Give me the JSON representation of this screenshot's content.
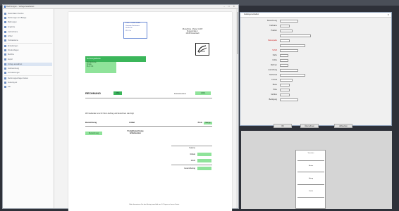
{
  "top_strip": {
    "title": ""
  },
  "window": {
    "title": "Rechnungen – Vorlage bearbeiten",
    "controls": "–  □  ✕"
  },
  "sidebar": {
    "items": [
      {
        "label": "Stammdaten Kunden"
      },
      {
        "label": "Rechnungen und Belege"
      },
      {
        "label": "Mahnungen"
      },
      {
        "label": "Angebote"
      },
      {
        "label": "Lieferscheine"
      },
      {
        "label": "Artikel"
      },
      {
        "label": "Textbausteine"
      },
      {
        "label": "Einstellungen"
      },
      {
        "label": "Druckvorlagen"
      },
      {
        "label": "Berichte"
      },
      {
        "label": "Export"
      },
      {
        "label": "Vorlage auswählen"
      },
      {
        "label": "Feldzuordnung"
      },
      {
        "label": "Formatierungen"
      },
      {
        "label": "Rechnungsvorlage drucken"
      },
      {
        "label": "Seitenlayout"
      },
      {
        "label": "Info"
      }
    ],
    "selected_index": 11
  },
  "invoice": {
    "recipient": [
      "Firma · Kunde GmbH",
      "Vorname Nachname",
      "Straße Nr.",
      "PLZ Ort"
    ],
    "sender": [
      "Musterfirma · Muster GmbH",
      "Musterstraße 1",
      "12345 Musterstadt"
    ],
    "green_head": "Rechnungsadresse",
    "green_box": [
      "Kundenname",
      "Straße",
      "PLZ / Ort"
    ],
    "title": "RECHNUNG",
    "number": "4711",
    "customer_no_label": "Kundennummer",
    "customer_no": "10001",
    "intro": "Wir bedanken uns für Ihren Auftrag und berechnen wie folgt:",
    "table": {
      "col1": "Bezeichnung",
      "col2": "Artikel",
      "col3": "Preis",
      "col3_val": "Menge"
    },
    "item": {
      "pill": "Bezeichnung",
      "desc": "Produktbezeichnung Artikelnummer",
      "amount": ""
    },
    "sums": [
      {
        "label": "Summe",
        "value": "",
        "green": false
      },
      {
        "label": "Rabatt",
        "value": "",
        "green": true
      },
      {
        "label": "MwSt",
        "value": "",
        "green": true
      },
      {
        "label": "Gesamtbetrag",
        "value": "",
        "green": true
      }
    ],
    "note": "",
    "footer": "Bitte überweisen Sie den Betrag innerhalb von 14 Tagen auf unser Konto."
  },
  "dialog": {
    "title": "Feldeigenschaften",
    "close": "✕",
    "fields": [
      {
        "label": "Bezeichnung",
        "value": "",
        "red": false,
        "side": ""
      },
      {
        "label": "Feldname",
        "value": "",
        "red": false,
        "side": ""
      },
      {
        "label": "Position",
        "value": "",
        "red": false,
        "side": ""
      },
      {
        "label": "",
        "value": "",
        "red": false,
        "side": ""
      },
      {
        "label": "Datenquelle",
        "value": "",
        "red": true,
        "side": ""
      },
      {
        "label": "",
        "value": "",
        "red": false,
        "side": ""
      },
      {
        "label": "Schrift",
        "value": "",
        "red": true,
        "side": ""
      },
      {
        "label": "Farbe",
        "value": "",
        "red": false,
        "side": ""
      },
      {
        "label": "Größe",
        "value": "",
        "red": false,
        "side": ""
      },
      {
        "label": "Rahmen",
        "value": "",
        "red": false,
        "side": ""
      },
      {
        "label": "Ausrichtung",
        "value": "",
        "red": false,
        "side": ""
      },
      {
        "label": "Textformat",
        "value": "",
        "red": false,
        "side": ""
      },
      {
        "label": "Format",
        "value": "",
        "red": false,
        "side": ""
      },
      {
        "label": "Breite",
        "value": "",
        "red": false,
        "side": ""
      },
      {
        "label": "Höhe",
        "value": "",
        "red": false,
        "side": ""
      },
      {
        "label": "Sichtbar",
        "value": "",
        "red": false,
        "side": ""
      },
      {
        "label": "Bedingung",
        "value": "",
        "red": false,
        "side": ""
      }
    ],
    "buttons": {
      "ok": "OK",
      "apply": "Übernehmen",
      "cancel": "Abbrechen"
    }
  },
  "card": {
    "lines": [
      "Vorschau",
      "",
      "Muster",
      "",
      "Betrag",
      "",
      "Kunde",
      ""
    ]
  }
}
